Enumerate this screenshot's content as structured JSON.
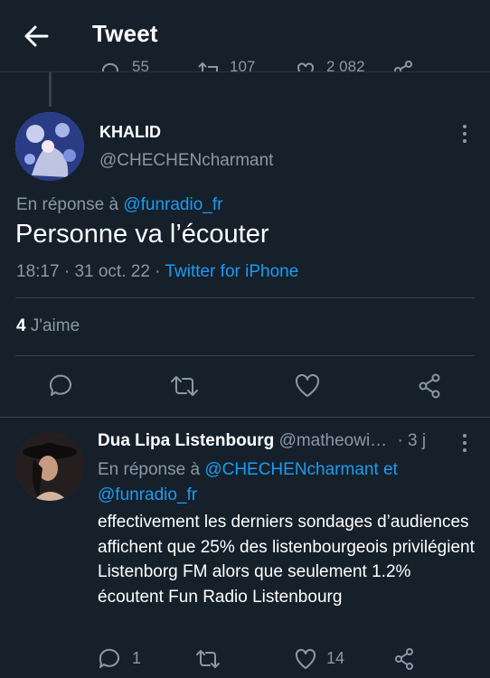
{
  "header": {
    "title": "Tweet",
    "prev_counts": [
      "55",
      "107",
      "2 082"
    ]
  },
  "main_tweet": {
    "display_name": "KHALID",
    "handle": "@CHECHENcharmant",
    "reply_prefix": "En réponse à",
    "reply_to": "@funradio_fr",
    "text": "Personne va l’écouter",
    "time": "18:17",
    "date": "31 oct. 22",
    "source": "Twitter for iPhone",
    "separator": "·",
    "likes_count": "4",
    "likes_label": "J'aime"
  },
  "reply_tweet": {
    "display_name": "Dua Lipa Listenbourg",
    "handle": "@matheowi…",
    "age": "· 3 j",
    "reply_prefix": "En réponse à",
    "reply_to_1": "@CHECHENcharmant",
    "reply_conj": "et",
    "reply_to_2": "@funradio_fr",
    "text": "effectivement les derniers sondages d’audiences affichent que 25% des listenbourgeois privilégient Listenborg FM alors que seulement 1.2% écoutent Fun Radio Listenbourg",
    "reply_count": "1",
    "like_count": "14"
  },
  "colors": {
    "background": "#15202b",
    "link": "#1d9bf0",
    "muted": "#8b98a5",
    "divider": "#38444d"
  },
  "icons": [
    "back-arrow-icon",
    "more-icon",
    "reply-icon",
    "retweet-icon",
    "like-icon",
    "share-icon"
  ]
}
